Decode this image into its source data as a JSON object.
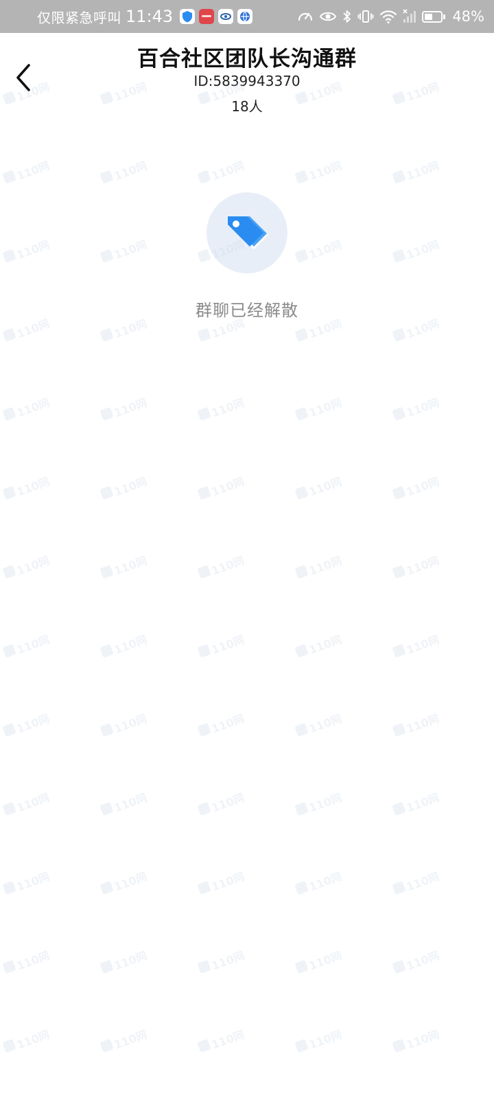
{
  "status_bar": {
    "carrier_text": "仅限紧急呼叫",
    "time": "11:43",
    "battery_text": "48%",
    "battery_level": 0.48,
    "app_icons": [
      "shield-app-icon",
      "red-app-icon",
      "white-app-icon",
      "globe-app-icon"
    ],
    "system_icons": [
      "speedometer-icon",
      "eye-icon",
      "bluetooth-icon",
      "vibrate-icon",
      "wifi-icon",
      "signal-icon",
      "battery-icon"
    ]
  },
  "header": {
    "title": "百合社区团队长沟通群",
    "group_id": "ID:5839943370",
    "member_count": "18人",
    "back_icon": "chevron-left-icon"
  },
  "empty_state": {
    "icon": "tag-icon",
    "message": "群聊已经解散",
    "icon_color": "#2a8cf0",
    "circle_color": "#e8eef7"
  },
  "watermark": {
    "text": "110网"
  },
  "colors": {
    "status_bar_bg": "#b4b4b4",
    "page_bg": "#ffffff",
    "accent": "#2a8cf0"
  }
}
